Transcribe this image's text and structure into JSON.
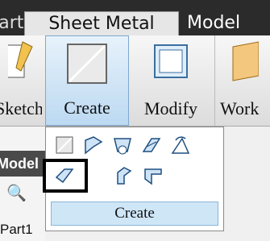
{
  "tabs": {
    "part": "Part",
    "sheet_metal": "Sheet Metal",
    "model": "Model"
  },
  "ribbon": {
    "sketch_label": "Sketch",
    "create_label": "Create",
    "modify_label": "Modify",
    "work_label": "Work"
  },
  "browser": {
    "title": "Model",
    "part_name": "Part1"
  },
  "dropdown": {
    "row1": [
      "face-icon",
      "contour-flange-icon",
      "cut-icon",
      "fold-icon",
      "unfold-icon"
    ],
    "row2": [
      "flange-icon",
      "hem-icon",
      "corner-seam-icon"
    ],
    "group_label": "Create"
  },
  "colors": {
    "tabbar": "#2b2b2b",
    "active": "#bcd9f1",
    "highlight": "#000000"
  }
}
